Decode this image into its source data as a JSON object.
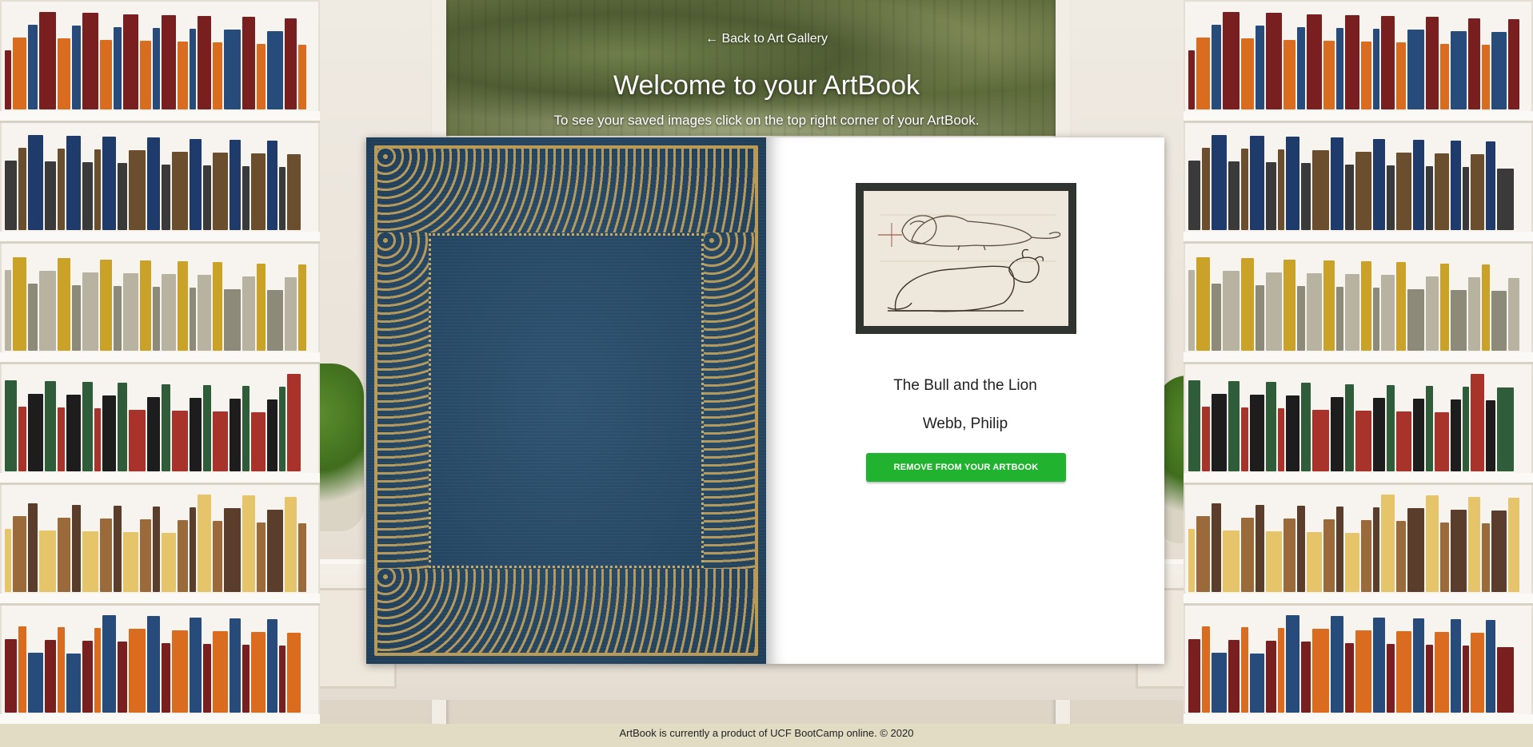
{
  "header": {
    "back_link": "← Back to Art Gallery",
    "title": "Welcome to your ArtBook",
    "subtitle": "To see your saved images click on the top right corner of your ArtBook."
  },
  "artwork": {
    "title": "The Bull and the Lion",
    "artist": "Webb, Philip",
    "remove_button": "REMOVE FROM YOUR ARTBOOK"
  },
  "footer": {
    "text": "ArtBook is currently a product of UCF BootCamp online. © 2020"
  },
  "colors": {
    "button_green": "#21b22f",
    "cover_blue": "#274965",
    "cover_gold": "#b99a57",
    "footer_bg": "#e1dcc3"
  }
}
